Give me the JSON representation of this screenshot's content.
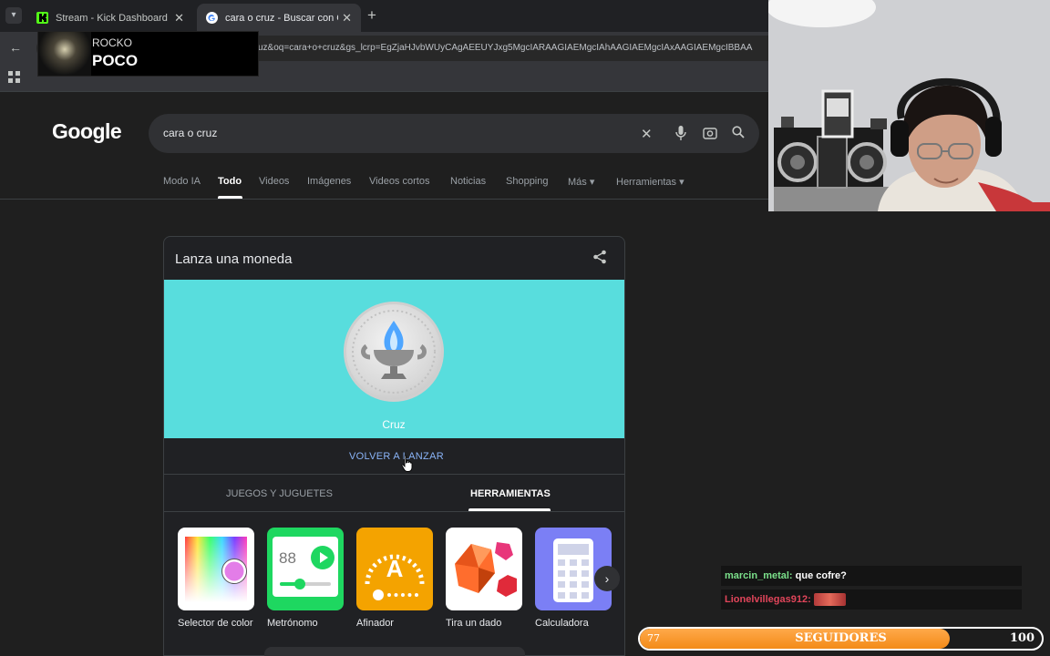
{
  "browser": {
    "tabs": [
      {
        "label": "Stream - Kick Dashboard",
        "icon": "kick-favicon"
      },
      {
        "label": "cara o cruz - Buscar con Google",
        "icon": "google-favicon"
      }
    ],
    "new_tab_glyph": "+",
    "tab_close_glyph": "✕",
    "url": "uz&oq=cara+o+cruz&gs_lcrp=EgZjaHJvbWUyCAgAEEUYJxg5MgcIARAAGIAEMgcIAhAAGIAEMgcIAxAAGIAEMgcIBBAA"
  },
  "now_playing": {
    "artist": "ROCKO",
    "song": "POCO"
  },
  "google": {
    "logo": "Google",
    "query": "cara o cruz",
    "nav_tabs": [
      {
        "label": "Modo IA"
      },
      {
        "label": "Todo"
      },
      {
        "label": "Videos"
      },
      {
        "label": "Imágenes"
      },
      {
        "label": "Videos cortos"
      },
      {
        "label": "Noticias"
      },
      {
        "label": "Shopping"
      },
      {
        "label": "Más"
      },
      {
        "label": "Herramientas"
      }
    ],
    "card": {
      "title": "Lanza una moneda",
      "coin_result": "Cruz",
      "reflip_label": "VOLVER A LANZAR",
      "tabs": [
        "JUEGOS Y JUGUETES",
        "HERRAMIENTAS"
      ],
      "tools": [
        {
          "label": "Selector de color",
          "icon": "color-picker-icon"
        },
        {
          "label": "Metrónomo",
          "icon": "metronome-icon",
          "display": "88"
        },
        {
          "label": "Afinador",
          "icon": "tuner-icon",
          "display": "A"
        },
        {
          "label": "Tira un dado",
          "icon": "dice-icon"
        },
        {
          "label": "Calculadora",
          "icon": "calculator-icon"
        }
      ],
      "next_glyph": "›"
    }
  },
  "chat": [
    {
      "user": "marcin_metal:",
      "text": " que cofre?"
    },
    {
      "user": "Lionelvillegas912:",
      "text": ""
    }
  ],
  "followers_goal": {
    "label": "SEGUIDORES",
    "current": "77",
    "goal": "100",
    "progress": 0.77
  },
  "colors": {
    "coin_panel": "#58dddd",
    "link_blue": "#8ab4f8",
    "follow_bar": "#f38b18"
  }
}
